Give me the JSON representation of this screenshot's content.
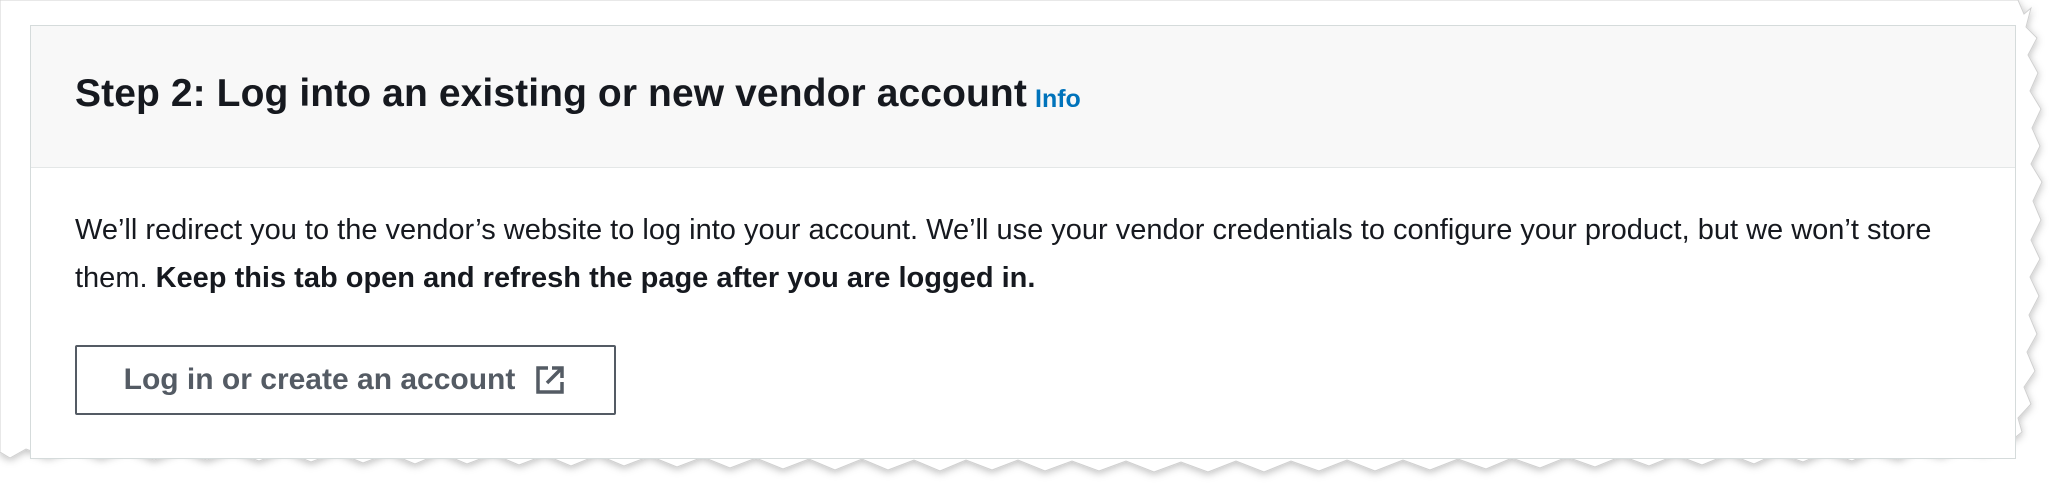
{
  "panel": {
    "title": "Step 2: Log into an existing or new vendor account",
    "info_label": "Info",
    "description_text": "We’ll redirect you to the vendor’s website to log into your account. We’ll use your vendor credentials to configure your product, but we won’t store them. ",
    "description_emphasis": "Keep this tab open and refresh the page after you are logged in.",
    "button_label": "Log in or create an account",
    "button_icon": "external-link-icon"
  },
  "colors": {
    "link": "#0073bb",
    "text": "#16191f",
    "button_border": "#545b64",
    "header_background": "#f8f8f8"
  }
}
